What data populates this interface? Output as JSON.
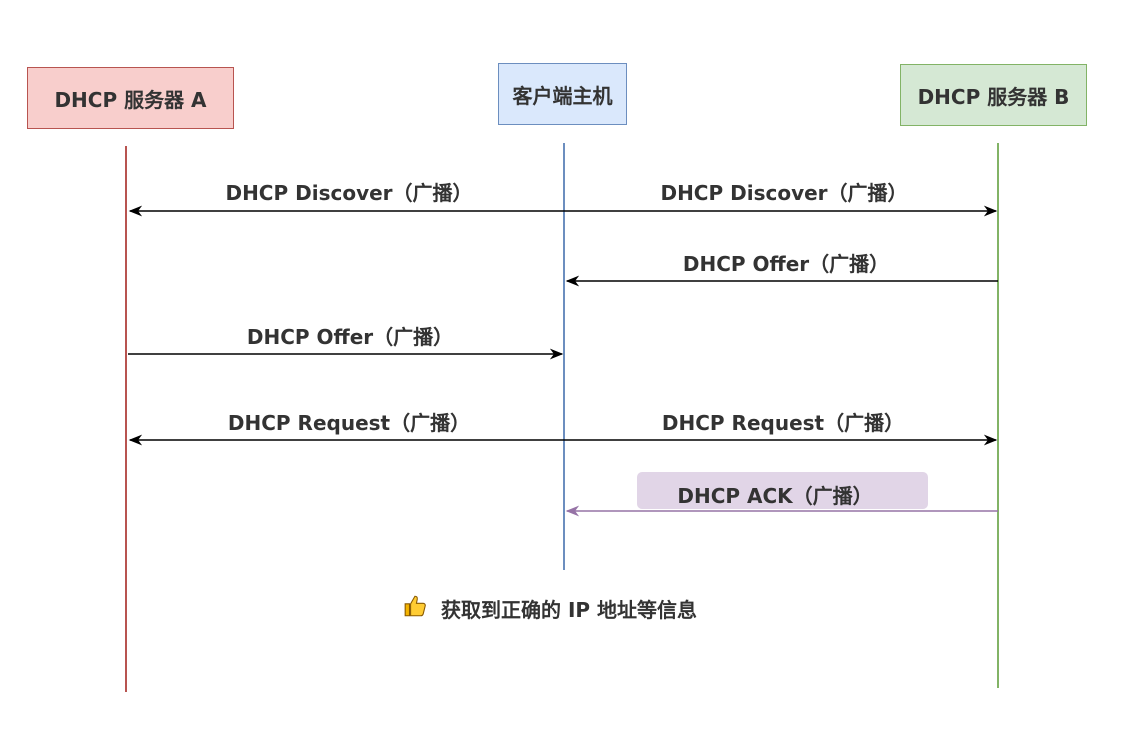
{
  "participants": {
    "server_a": "DHCP 服务器 A",
    "client": "客户端主机",
    "server_b": "DHCP 服务器 B"
  },
  "messages": {
    "discover_a": "DHCP Discover（广播）",
    "discover_b": "DHCP Discover（广播）",
    "offer_b": "DHCP Offer（广播）",
    "offer_a": "DHCP Offer（广播）",
    "request_a": "DHCP Request（广播）",
    "request_b": "DHCP Request（广播）",
    "ack_b": "DHCP ACK（广播）"
  },
  "result": {
    "icon": "thumbs-up-icon",
    "text": "获取到正确的 IP 地址等信息"
  },
  "colors": {
    "server_a_fill": "#f8cecc",
    "server_a_stroke": "#b85450",
    "client_fill": "#dae8fc",
    "client_stroke": "#6c8ebf",
    "server_b_fill": "#d5e8d4",
    "server_b_stroke": "#82b366",
    "ack_fill": "#e1d5e7",
    "ack_stroke": "#9673a6"
  }
}
